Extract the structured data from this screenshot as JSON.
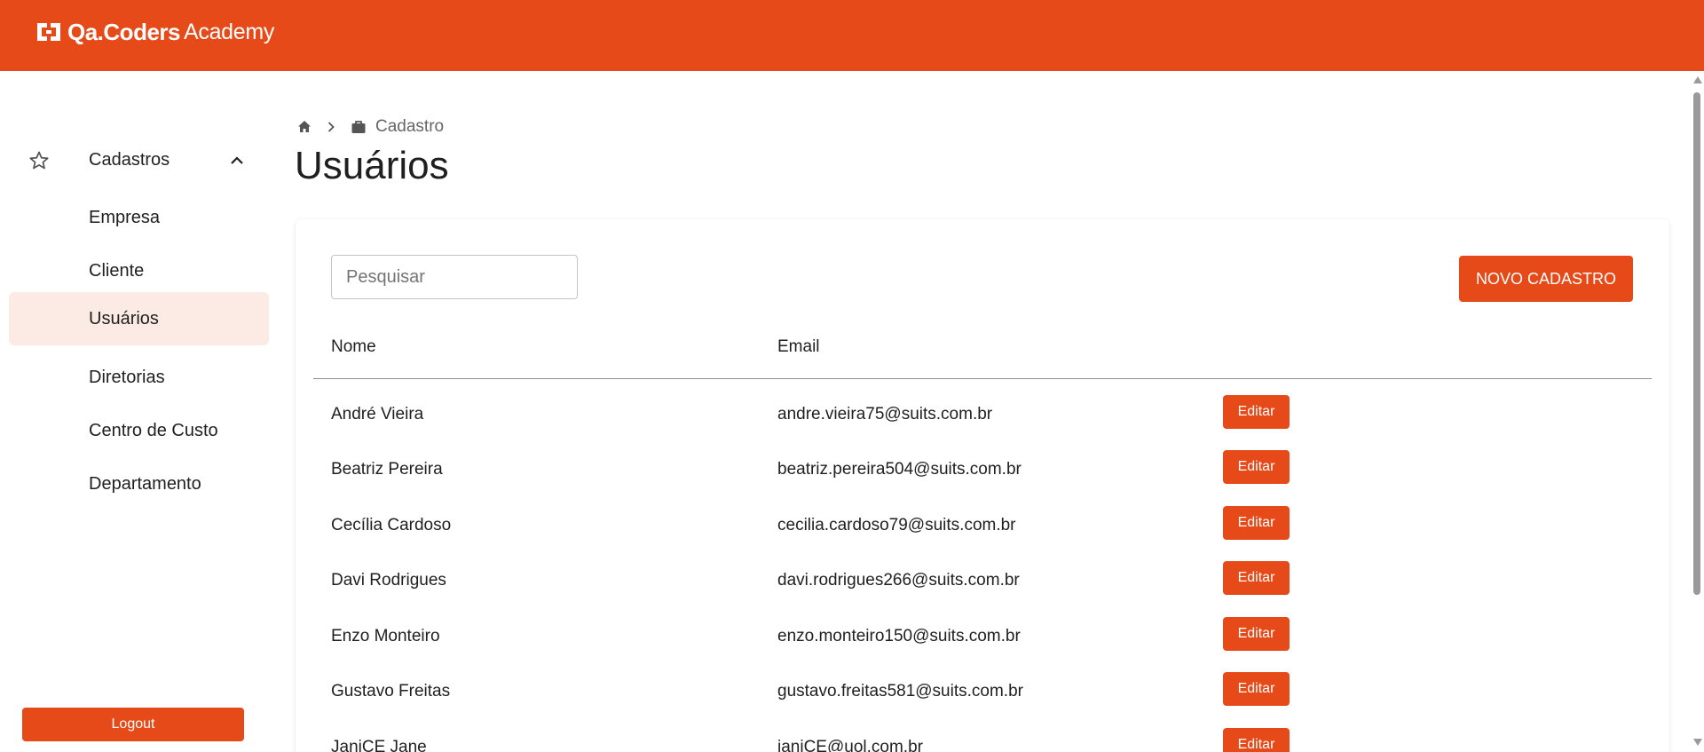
{
  "brand": {
    "name": "Qa.Coders",
    "suffix": "Academy",
    "color": "#e64a19"
  },
  "sidebar": {
    "group": {
      "label": "Cadastros",
      "icon": "star-icon",
      "expanded_icon": "chevron-up-icon"
    },
    "items": [
      {
        "label": "Empresa",
        "active": false
      },
      {
        "label": "Cliente",
        "active": false
      },
      {
        "label": "Usuários",
        "active": true
      },
      {
        "label": "Diretorias",
        "active": false
      },
      {
        "label": "Centro de Custo",
        "active": false
      },
      {
        "label": "Departamento",
        "active": false
      }
    ],
    "logout_label": "Logout"
  },
  "breadcrumb": {
    "home_icon": "home-icon",
    "separator_icon": "chevron-right-icon",
    "section_icon": "briefcase-icon",
    "section": "Cadastro"
  },
  "page": {
    "title": "Usuários"
  },
  "toolbar": {
    "search_placeholder": "Pesquisar",
    "search_value": "",
    "new_button_label": "NOVO CADASTRO"
  },
  "table": {
    "columns": [
      "Nome",
      "Email"
    ],
    "edit_label": "Editar",
    "rows": [
      {
        "nome": "André Vieira",
        "email": "andre.vieira75@suits.com.br"
      },
      {
        "nome": "Beatriz Pereira",
        "email": "beatriz.pereira504@suits.com.br"
      },
      {
        "nome": "Cecília Cardoso",
        "email": "cecilia.cardoso79@suits.com.br"
      },
      {
        "nome": "Davi Rodrigues",
        "email": "davi.rodrigues266@suits.com.br"
      },
      {
        "nome": "Enzo Monteiro",
        "email": "enzo.monteiro150@suits.com.br"
      },
      {
        "nome": "Gustavo Freitas",
        "email": "gustavo.freitas581@suits.com.br"
      },
      {
        "nome": "JaniCE Jane",
        "email": "janiCE@uol.com.br"
      }
    ]
  }
}
